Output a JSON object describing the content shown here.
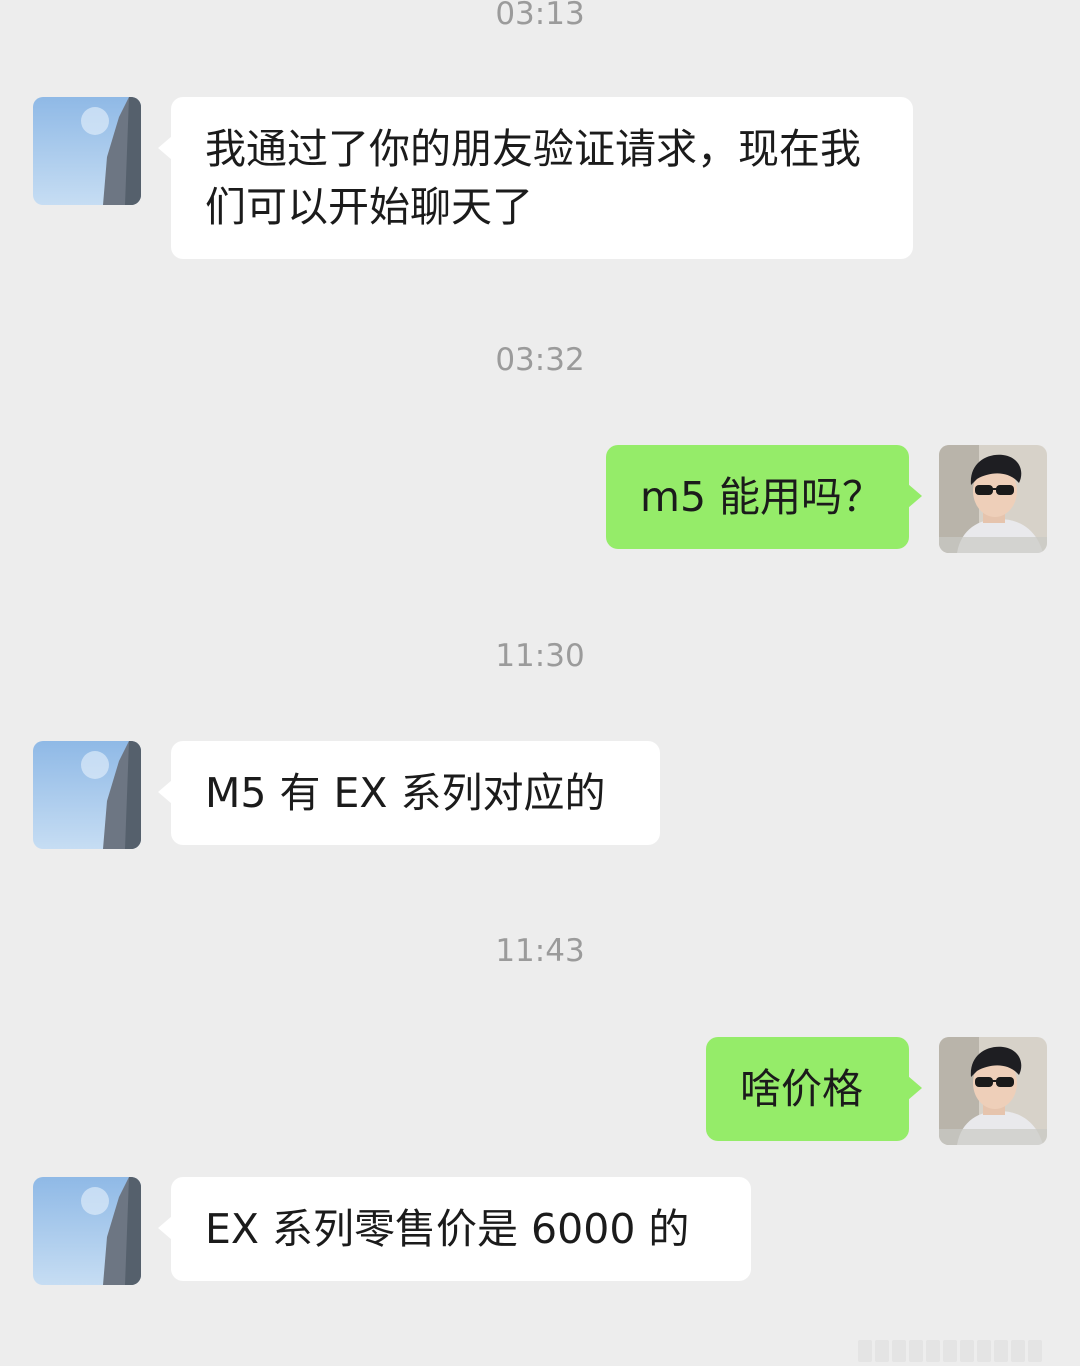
{
  "chat": {
    "timestamps": [
      "03:13",
      "03:32",
      "11:30",
      "11:43"
    ],
    "messages": [
      {
        "sender": "contact",
        "text": "我通过了你的朋友验证请求，现在我们可以开始聊天了"
      },
      {
        "sender": "me",
        "text": "m5 能用吗？"
      },
      {
        "sender": "contact",
        "text": "M5 有 EX 系列对应的"
      },
      {
        "sender": "me",
        "text": "啥价格"
      },
      {
        "sender": "contact",
        "text": "EX 系列零售价是 6000 的"
      }
    ]
  },
  "avatars": {
    "contact": "sky-building-avatar",
    "me": "man-sunglasses-avatar"
  },
  "colors": {
    "background": "#ededed",
    "incoming_bubble": "#ffffff",
    "outgoing_bubble": "#95ec69",
    "timestamp_text": "#9b9b9b"
  }
}
